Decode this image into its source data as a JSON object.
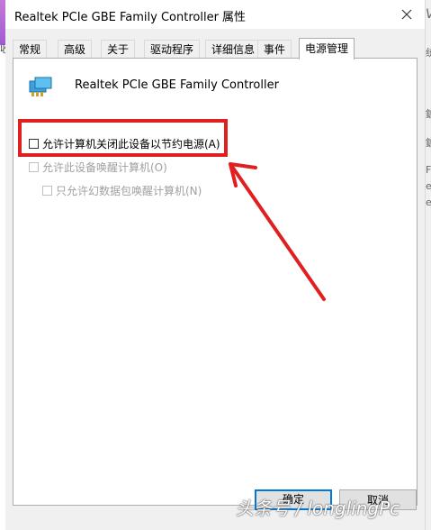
{
  "window": {
    "title": "Realtek PCIe GBE Family Controller 属性"
  },
  "tabs": [
    {
      "label": "常规"
    },
    {
      "label": "高级"
    },
    {
      "label": "关于"
    },
    {
      "label": "驱动程序"
    },
    {
      "label": "详细信息"
    },
    {
      "label": "事件"
    },
    {
      "label": "电源管理"
    }
  ],
  "active_tab": "电源管理",
  "device": {
    "name": "Realtek PCIe GBE Family Controller",
    "icon": "network-adapter-icon"
  },
  "options": [
    {
      "label": "允许计算机关闭此设备以节约电源(A)",
      "checked": false,
      "enabled": true
    },
    {
      "label": "允许此设备唤醒计算机(O)",
      "checked": false,
      "enabled": false
    },
    {
      "label": "只允许幻数据包唤醒计算机(N)",
      "checked": false,
      "enabled": false
    }
  ],
  "buttons": {
    "ok": "确定",
    "cancel": "取消"
  },
  "background": {
    "letters": [
      "Va",
      "统",
      "鑢",
      "F",
      "e"
    ],
    "left_char": "收"
  },
  "watermark": "头条号 / longlingPc",
  "colors": {
    "highlight_red": "#e02020",
    "accent_blue": "#0078d7"
  }
}
